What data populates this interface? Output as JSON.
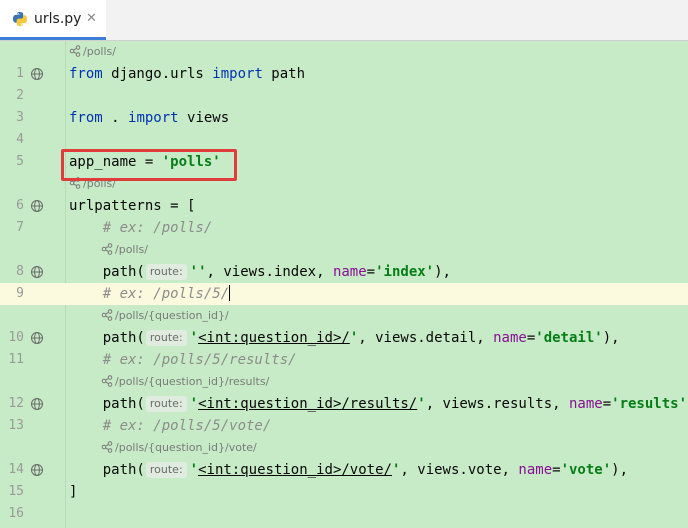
{
  "tab": {
    "label": "urls.py",
    "close": "✕",
    "icon": "python-icon"
  },
  "lines": {
    "l1": {
      "n": "1",
      "kw1": "from",
      "t1": " django.urls ",
      "kw2": "import",
      "t2": " path"
    },
    "l2": {
      "n": "2"
    },
    "l3": {
      "n": "3",
      "kw1": "from",
      "t1": " . ",
      "kw2": "import",
      "t2": " views"
    },
    "l4": {
      "n": "4"
    },
    "l5": {
      "n": "5",
      "t1": "app_name = ",
      "s1": "'polls'"
    },
    "l6": {
      "n": "6",
      "t1": "urlpatterns = ["
    },
    "l7": {
      "n": "7",
      "c": "# ex: /polls/"
    },
    "l8": {
      "n": "8",
      "t1": "path(",
      "hint": "route:",
      "s1": "''",
      "t2": ", views.index, ",
      "p": "name",
      "t3": "=",
      "s2": "'index'",
      "t4": "),"
    },
    "l9": {
      "n": "9",
      "c": "# ex: /polls/5/"
    },
    "l10": {
      "n": "10",
      "t1": "path(",
      "hint": "route:",
      "q1": "'",
      "u": "<int:question_id>/",
      "q2": "'",
      "t2": ", views.detail, ",
      "p": "name",
      "t3": "=",
      "s2": "'detail'",
      "t4": "),"
    },
    "l11": {
      "n": "11",
      "c": "# ex: /polls/5/results/"
    },
    "l12": {
      "n": "12",
      "t1": "path(",
      "hint": "route:",
      "q1": "'",
      "u": "<int:question_id>/results/",
      "q2": "'",
      "t2": ", views.results, ",
      "p": "name",
      "t3": "=",
      "s2": "'results'",
      "t4": "),"
    },
    "l13": {
      "n": "13",
      "c": "# ex: /polls/5/vote/"
    },
    "l14": {
      "n": "14",
      "t1": "path(",
      "hint": "route:",
      "q1": "'",
      "u": "<int:question_id>/vote/",
      "q2": "'",
      "t2": ", views.vote, ",
      "p": "name",
      "t3": "=",
      "s2": "'vote'",
      "t4": "),"
    },
    "l15": {
      "n": "15",
      "t1": "]"
    },
    "l16": {
      "n": "16"
    }
  },
  "lenses": {
    "top": "/polls/",
    "after5": "/polls/",
    "before8": "/polls/",
    "before10": "/polls/{question_id}/",
    "before12": "/polls/{question_id}/results/",
    "before14": "/polls/{question_id}/vote/"
  },
  "colors": {
    "editor_bg": "#c7ebc7",
    "current_line": "#fbfadf",
    "highlight_box": "#e03c3c",
    "keyword": "#0033b3",
    "string": "#067d17"
  }
}
